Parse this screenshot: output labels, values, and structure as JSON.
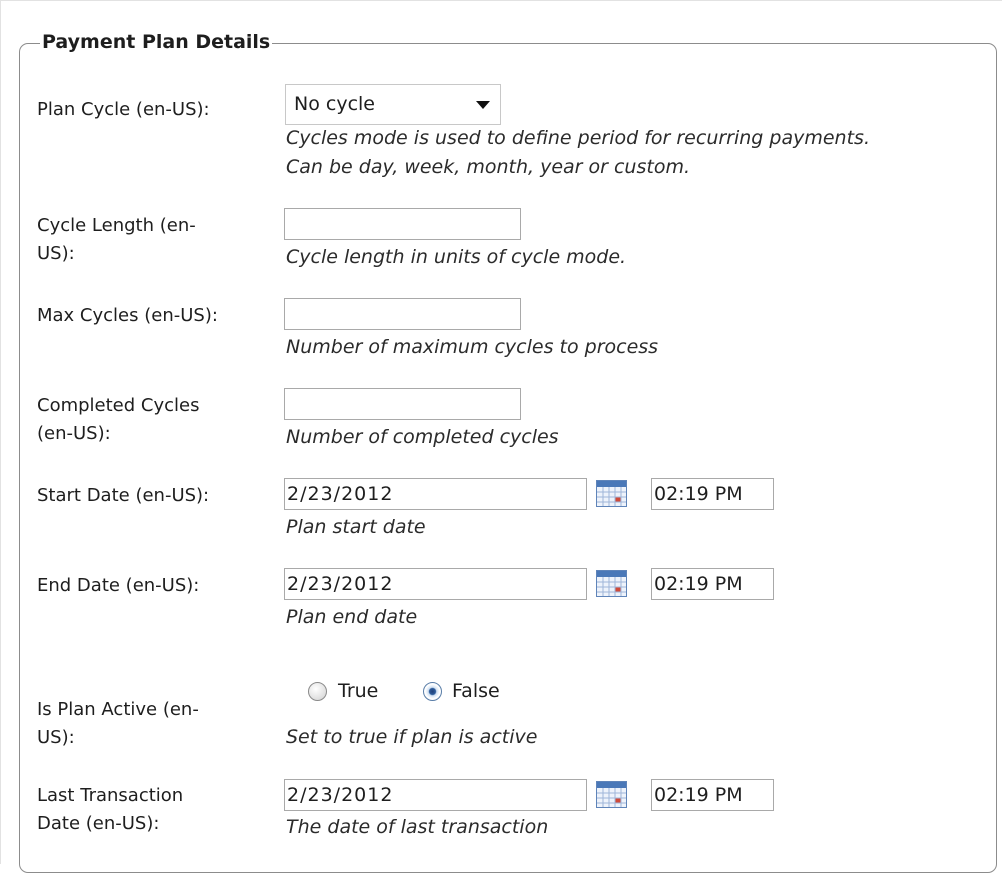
{
  "section": {
    "legend": "Payment Plan Details"
  },
  "fields": {
    "plan_cycle": {
      "label": "Plan Cycle (en-US):",
      "value": "No cycle",
      "help_line1": "Cycles mode is used to define period for recurring payments.",
      "help_line2": "Can be day, week, month, year or custom."
    },
    "cycle_length": {
      "label_line1": "Cycle Length (en-",
      "label_line2": "US):",
      "value": "",
      "help": "Cycle length in units of cycle mode."
    },
    "max_cycles": {
      "label": "Max Cycles (en-US):",
      "value": "",
      "help": "Number of maximum cycles to process"
    },
    "completed_cycles": {
      "label_line1": "Completed Cycles",
      "label_line2": "(en-US):",
      "value": "",
      "help": "Number of completed cycles"
    },
    "start_date": {
      "label": "Start Date (en-US):",
      "date": "2/23/2012",
      "time": "02:19 PM",
      "help": "Plan start date"
    },
    "end_date": {
      "label": "End Date (en-US):",
      "date": "2/23/2012",
      "time": "02:19 PM",
      "help": "Plan end date"
    },
    "is_plan_active": {
      "label_line1": "Is Plan Active (en-",
      "label_line2": "US):",
      "option_true": "True",
      "option_false": "False",
      "selected": "False",
      "help": "Set to true if plan is active"
    },
    "last_transaction_date": {
      "label_line1": "Last Transaction",
      "label_line2": "Date (en-US):",
      "date": "2/23/2012",
      "time": "02:19 PM",
      "help": "The date of last transaction"
    }
  },
  "icons": {
    "calendar": "calendar-icon",
    "dropdown": "chevron-down-icon"
  },
  "colors": {
    "calendar_blue": "#4a78b8",
    "calendar_red": "#d04a3a",
    "radio_selected": "#2e5d9c"
  }
}
